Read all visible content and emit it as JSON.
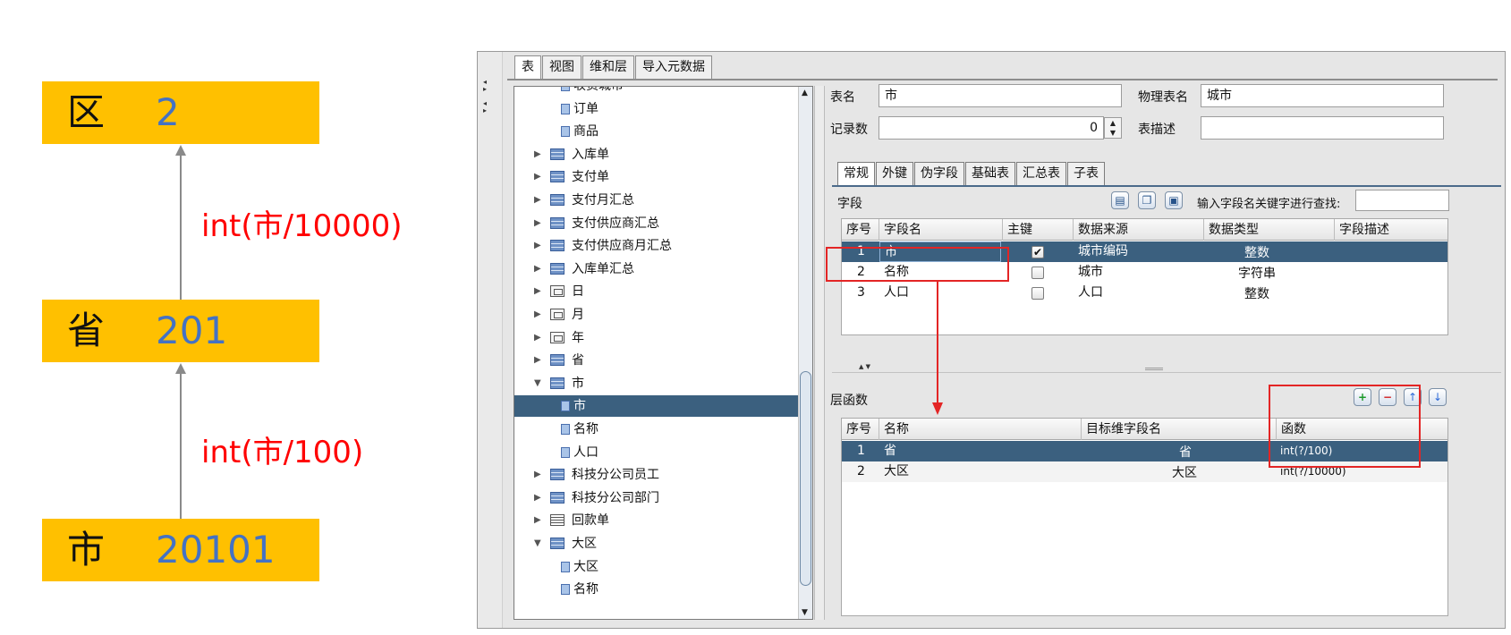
{
  "diagram": {
    "levels": [
      {
        "name": "区",
        "code": "2"
      },
      {
        "name": "省",
        "code": "201"
      },
      {
        "name": "市",
        "code": "20101"
      }
    ],
    "formulas": [
      "int(市/10000)",
      "int(市/100)"
    ]
  },
  "window": {
    "top_tabs": [
      "表",
      "视图",
      "维和层",
      "导入元数据"
    ],
    "tree": [
      {
        "label": "收货城市",
        "type": "field"
      },
      {
        "label": "订单",
        "type": "field"
      },
      {
        "label": "商品",
        "type": "field"
      },
      {
        "label": "入库单",
        "type": "table",
        "expander": "▶"
      },
      {
        "label": "支付单",
        "type": "table",
        "expander": "▶"
      },
      {
        "label": "支付月汇总",
        "type": "table",
        "expander": "▶"
      },
      {
        "label": "支付供应商汇总",
        "type": "table",
        "expander": "▶"
      },
      {
        "label": "支付供应商月汇总",
        "type": "table",
        "expander": "▶"
      },
      {
        "label": "入库单汇总",
        "type": "table",
        "expander": "▶"
      },
      {
        "label": "日",
        "type": "dim",
        "expander": "▶"
      },
      {
        "label": "月",
        "type": "dim",
        "expander": "▶"
      },
      {
        "label": "年",
        "type": "dim",
        "expander": "▶"
      },
      {
        "label": "省",
        "type": "table",
        "expander": "▶"
      },
      {
        "label": "市",
        "type": "table",
        "expander": "▼"
      },
      {
        "label": "市",
        "type": "field",
        "selected": true
      },
      {
        "label": "名称",
        "type": "field"
      },
      {
        "label": "人口",
        "type": "field"
      },
      {
        "label": "科技分公司员工",
        "type": "table",
        "expander": "▶"
      },
      {
        "label": "科技分公司部门",
        "type": "table",
        "expander": "▶"
      },
      {
        "label": "回款单",
        "type": "plain",
        "expander": "▶"
      },
      {
        "label": "大区",
        "type": "table",
        "expander": "▼"
      },
      {
        "label": "大区",
        "type": "field"
      },
      {
        "label": "名称",
        "type": "field"
      }
    ],
    "form": {
      "table_name_label": "表名",
      "table_name_value": "市",
      "physical_name_label": "物理表名",
      "physical_name_value": "城市",
      "record_count_label": "记录数",
      "record_count_value": "0",
      "table_desc_label": "表描述",
      "table_desc_value": ""
    },
    "sub_tabs": [
      "常规",
      "外键",
      "伪字段",
      "基础表",
      "汇总表",
      "子表"
    ],
    "fields_section": {
      "title": "字段",
      "search_label": "输入字段名关键字进行查找:",
      "columns": [
        "序号",
        "字段名",
        "主键",
        "数据来源",
        "数据类型",
        "字段描述"
      ],
      "rows": [
        {
          "no": "1",
          "name": "市",
          "pk": true,
          "source": "城市编码",
          "dtype": "整数",
          "desc": ""
        },
        {
          "no": "2",
          "name": "名称",
          "pk": false,
          "source": "城市",
          "dtype": "字符串",
          "desc": ""
        },
        {
          "no": "3",
          "name": "人口",
          "pk": false,
          "source": "人口",
          "dtype": "整数",
          "desc": ""
        }
      ]
    },
    "layer_section": {
      "title": "层函数",
      "columns": [
        "序号",
        "名称",
        "目标维字段名",
        "函数"
      ],
      "rows": [
        {
          "no": "1",
          "name": "省",
          "target": "省",
          "func": "int(?/100)"
        },
        {
          "no": "2",
          "name": "大区",
          "target": "大区",
          "func": "int(?/10000)"
        }
      ]
    }
  },
  "colors": {
    "level_fill": "#FFC000",
    "code_text": "#4472C4",
    "formula_text": "#FF0000",
    "selection": "#3B607F",
    "annotation": "#E32525"
  }
}
